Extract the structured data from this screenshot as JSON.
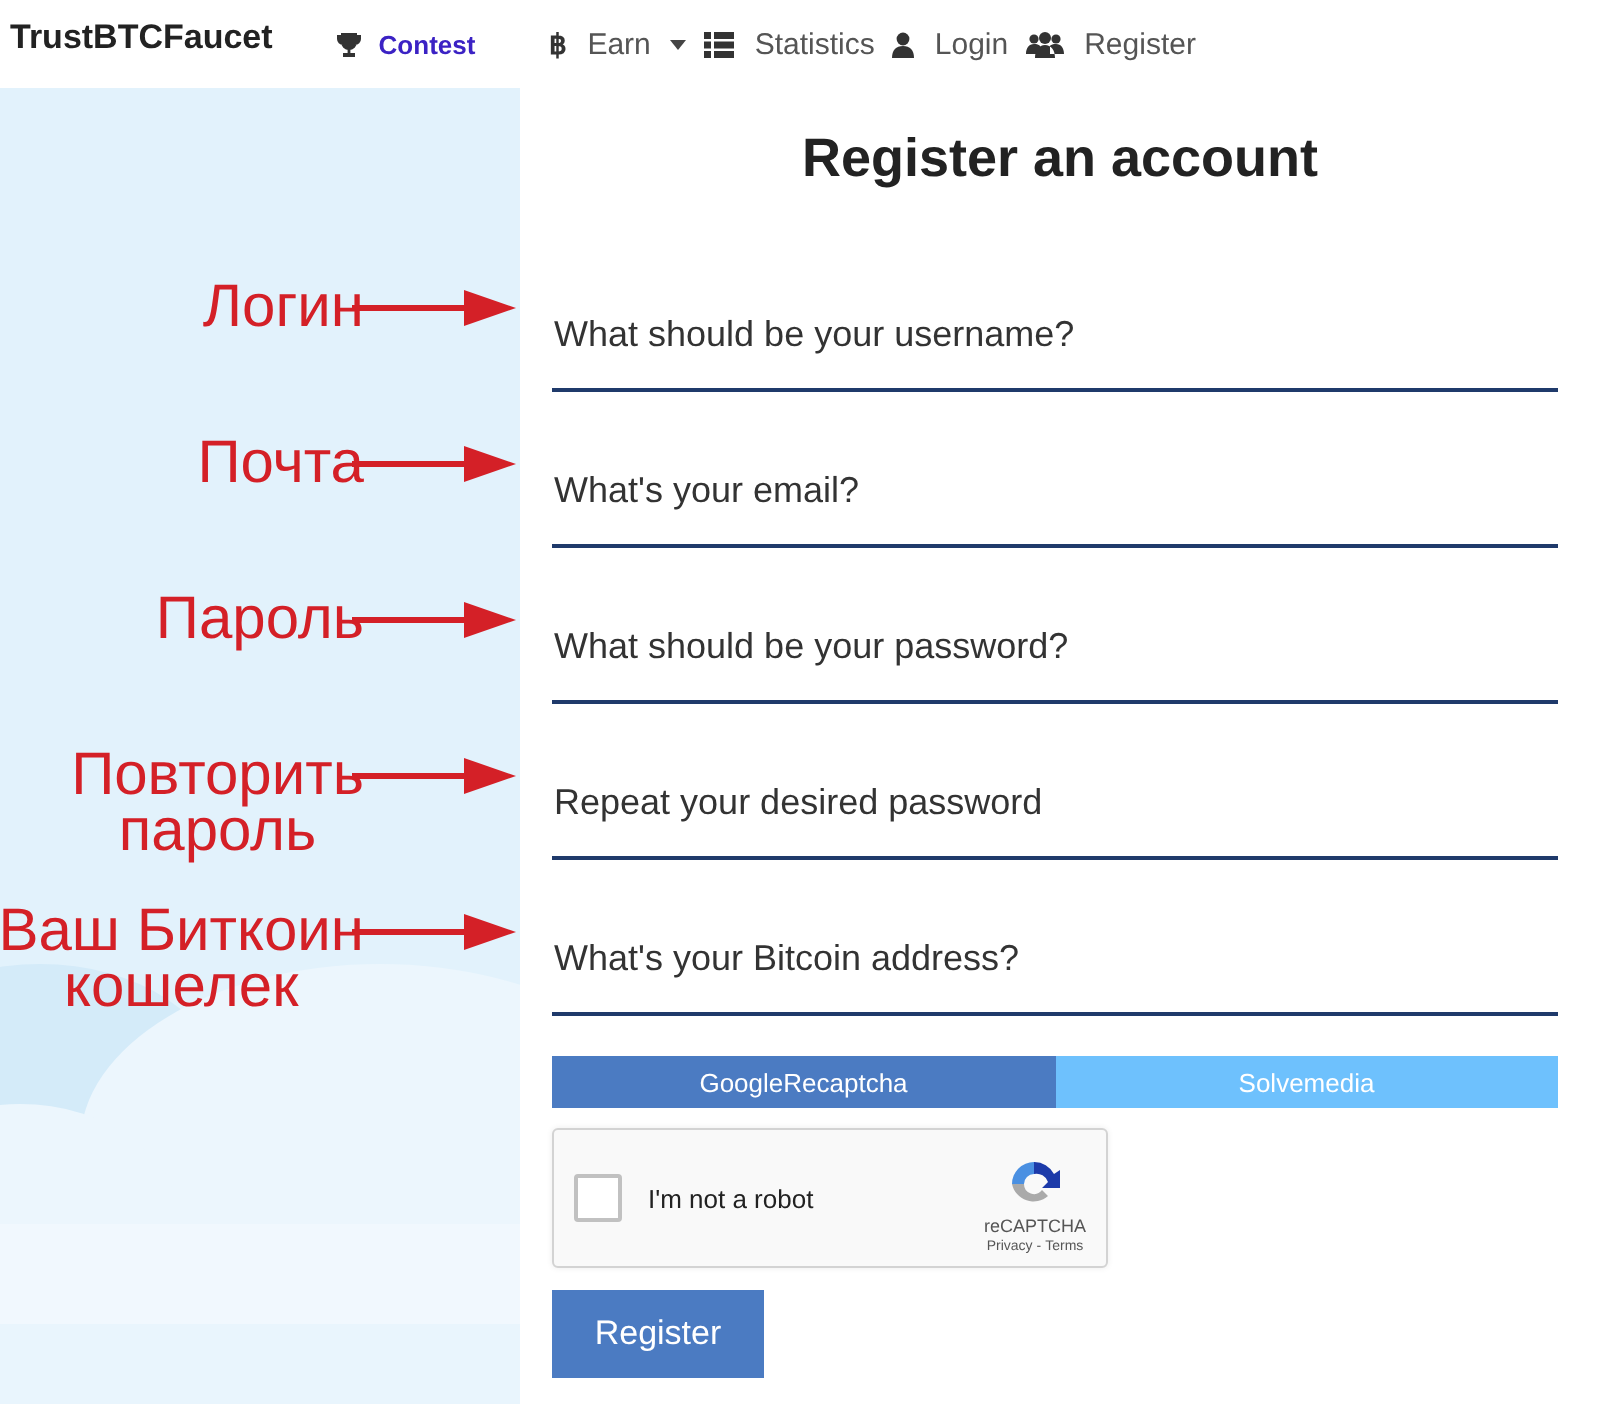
{
  "header": {
    "brand": "TrustBTCFaucet",
    "contest": "Contest",
    "nav": [
      {
        "label": "Earn",
        "kind": "bitcoin",
        "icon": "฿",
        "dropdown": true
      },
      {
        "label": "Statistics",
        "kind": "list"
      },
      {
        "label": "Login",
        "kind": "user"
      },
      {
        "label": "Register",
        "kind": "users"
      }
    ]
  },
  "title": "Register an account",
  "fields": [
    {
      "placeholder": "What should be your username?",
      "annotation": "Логин"
    },
    {
      "placeholder": "What's your email?",
      "annotation": "Почта"
    },
    {
      "placeholder": "What should be your password?",
      "annotation": "Пароль"
    },
    {
      "placeholder": "Repeat your desired password",
      "annotation": "Повторить\nпароль"
    },
    {
      "placeholder": "What's your Bitcoin address?",
      "annotation": "Ваш Биткоин\nкошелек"
    }
  ],
  "captcha_tabs": [
    {
      "label": "GoogleRecaptcha",
      "selected": true
    },
    {
      "label": "Solvemedia",
      "selected": false
    }
  ],
  "recaptcha": {
    "checked": false,
    "label": "I'm not a robot",
    "brand": "reCAPTCHA",
    "links": [
      "Privacy",
      "Terms"
    ],
    "separator": "-"
  },
  "submit": "Register"
}
